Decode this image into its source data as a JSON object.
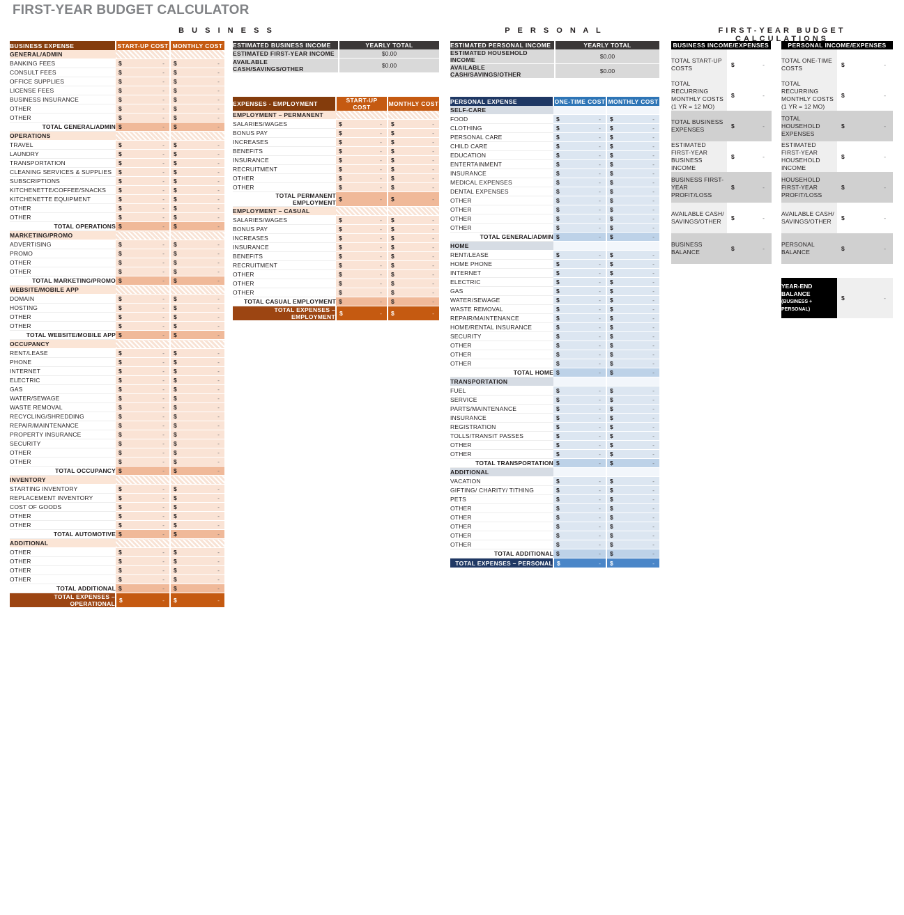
{
  "title": "FIRST-YEAR BUDGET CALCULATOR",
  "column_headings": {
    "business": "B U S I N E S S",
    "personal": "P E R S O N A L",
    "calculations": "FIRST-YEAR BUDGET CALCULATIONS"
  },
  "currency_symbol": "$",
  "empty_value": "-",
  "business_expense_table": {
    "header": {
      "label": "BUSINESS EXPENSE",
      "col1": "START-UP COST",
      "col2": "MONTHLY COST"
    },
    "sections": [
      {
        "name": "GENERAL/ADMIN",
        "items": [
          "BANKING FEES",
          "CONSULT FEES",
          "OFFICE SUPPLIES",
          "LICENSE FEES",
          "BUSINESS INSURANCE",
          "OTHER",
          "OTHER"
        ],
        "total_label": "TOTAL GENERAL/ADMIN"
      },
      {
        "name": "OPERATIONS",
        "items": [
          "TRAVEL",
          "LAUNDRY",
          "TRANSPORTATION",
          "CLEANING SERVICES & SUPPLIES",
          "SUBSCRIPTIONS",
          "KITCHENETTE/COFFEE/SNACKS",
          "KITCHENETTE EQUIPMENT",
          "OTHER",
          "OTHER"
        ],
        "total_label": "TOTAL OPERATIONS"
      },
      {
        "name": "MARKETING/PROMO",
        "items": [
          "ADVERTISING",
          "PROMO",
          "OTHER",
          "OTHER"
        ],
        "total_label": "TOTAL MARKETING/PROMO"
      },
      {
        "name": "WEBSITE/MOBILE APP",
        "items": [
          "DOMAIN",
          "HOSTING",
          "OTHER",
          "OTHER"
        ],
        "total_label": "TOTAL WEBSITE/MOBILE APP"
      },
      {
        "name": "OCCUPANCY",
        "items": [
          "RENT/LEASE",
          "PHONE",
          "INTERNET",
          "ELECTRIC",
          "GAS",
          "WATER/SEWAGE",
          "WASTE REMOVAL",
          "RECYCLING/SHREDDING",
          "REPAIR/MAINTENANCE",
          "PROPERTY INSURANCE",
          "SECURITY",
          "OTHER",
          "OTHER"
        ],
        "total_label": "TOTAL OCCUPANCY"
      },
      {
        "name": "INVENTORY",
        "items": [
          "STARTING INVENTORY",
          "REPLACEMENT INVENTORY",
          "COST OF GOODS",
          "OTHER",
          "OTHER"
        ],
        "total_label": "TOTAL AUTOMOTIVE"
      },
      {
        "name": "ADDITIONAL",
        "items": [
          "OTHER",
          "OTHER",
          "OTHER",
          "OTHER"
        ],
        "total_label": "TOTAL ADDITIONAL"
      }
    ],
    "grand_total_label": "TOTAL EXPENSES – OPERATIONAL"
  },
  "business_income_table": {
    "header": {
      "label": "ESTIMATED BUSINESS INCOME",
      "total": "YEARLY TOTAL"
    },
    "rows": [
      {
        "label": "ESTIMATED FIRST-YEAR INCOME",
        "value": "$0.00"
      },
      {
        "label": "AVAILABLE CASH/SAVINGS/OTHER",
        "value": "$0.00"
      }
    ]
  },
  "employment_table": {
    "header": {
      "label": "EXPENSES - EMPLOYMENT",
      "col1": "START-UP COST",
      "col2": "MONTHLY COST"
    },
    "sections": [
      {
        "name": "EMPLOYMENT – PERMANENT",
        "items": [
          "SALARIES/WAGES",
          "BONUS PAY",
          "INCREASES",
          "BENEFITS",
          "INSURANCE",
          "RECRUITMENT",
          "OTHER",
          "OTHER"
        ],
        "total_label": "TOTAL PERMANENT EMPLOYMENT"
      },
      {
        "name": "EMPLOYMENT – CASUAL",
        "items": [
          "SALARIES/WAGES",
          "BONUS PAY",
          "INCREASES",
          "INSURANCE",
          "BENEFITS",
          "RECRUITMENT",
          "OTHER",
          "OTHER",
          "OTHER"
        ],
        "total_label": "TOTAL CASUAL EMPLOYMENT"
      }
    ],
    "grand_total_label": "TOTAL EXPENSES – EMPLOYMENT"
  },
  "personal_income_table": {
    "header": {
      "label": "ESTIMATED PERSONAL INCOME",
      "total": "YEARLY TOTAL"
    },
    "rows": [
      {
        "label": "ESTIMATED HOUSEHOLD INCOME",
        "value": "$0.00"
      },
      {
        "label": "AVAILABLE CASH/SAVINGS/OTHER",
        "value": "$0.00"
      }
    ]
  },
  "personal_expense_table": {
    "header": {
      "label": "PERSONAL EXPENSE",
      "col1": "ONE-TIME COST",
      "col2": "MONTHLY COST"
    },
    "sections": [
      {
        "name": "SELF-CARE",
        "items": [
          "FOOD",
          "CLOTHING",
          "PERSONAL CARE",
          "CHILD CARE",
          "EDUCATION",
          "ENTERTAINMENT",
          "INSURANCE",
          "MEDICAL EXPENSES",
          "DENTAL EXPENSES",
          "OTHER",
          "OTHER",
          "OTHER",
          "OTHER"
        ],
        "total_label": "TOTAL GENERAL/ADMIN"
      },
      {
        "name": "HOME",
        "items": [
          "RENT/LEASE",
          "HOME PHONE",
          "INTERNET",
          "ELECTRIC",
          "GAS",
          "WATER/SEWAGE",
          "WASTE REMOVAL",
          "REPAIR/MAINTENANCE",
          "HOME/RENTAL INSURANCE",
          "SECURITY",
          "OTHER",
          "OTHER",
          "OTHER"
        ],
        "total_label": "TOTAL HOME"
      },
      {
        "name": "TRANSPORTATION",
        "items": [
          "FUEL",
          "SERVICE",
          "PARTS/MAINTENANCE",
          "INSURANCE",
          "REGISTRATION",
          "TOLLS/TRANSIT PASSES",
          "OTHER",
          "OTHER"
        ],
        "total_label": "TOTAL TRANSPORTATION"
      },
      {
        "name": "ADDITIONAL",
        "items": [
          "VACATION",
          "GIFTING/ CHARITY/ TITHING",
          "PETS",
          "OTHER",
          "OTHER",
          "OTHER",
          "OTHER",
          "OTHER"
        ],
        "total_label": "TOTAL ADDITIONAL"
      }
    ],
    "grand_total_label": "TOTAL EXPENSES – PERSONAL"
  },
  "calculations": {
    "header_business": "BUSINESS INCOME/EXPENSES",
    "header_personal": "PERSONAL INCOME/EXPENSES",
    "rows": [
      {
        "business": "TOTAL START-UP COSTS",
        "personal": "TOTAL ONE-TIME COSTS",
        "shade": "light"
      },
      {
        "business": "TOTAL RECURRING MONTHLY COSTS (1 YR = 12 MO)",
        "personal": "TOTAL RECURRING MONTHLY COSTS (1 YR = 12 MO)",
        "shade": "light"
      },
      {
        "business": "TOTAL BUSINESS EXPENSES",
        "personal": "TOTAL HOUSEHOLD EXPENSES",
        "shade": "grey"
      },
      {
        "business": "ESTIMATED FIRST-YEAR BUSINESS INCOME",
        "personal": "ESTIMATED FIRST-YEAR HOUSEHOLD INCOME",
        "shade": "light"
      },
      {
        "business": "BUSINESS FIRST-YEAR PROFIT/LOSS",
        "personal": "HOUSEHOLD FIRST-YEAR PROFIT/LOSS",
        "shade": "grey"
      },
      {
        "business": "AVAILABLE CASH/ SAVINGS/OTHER",
        "personal": "AVAILABLE CASH/ SAVINGS/OTHER",
        "shade": "light"
      },
      {
        "business": "BUSINESS BALANCE",
        "personal": "PERSONAL BALANCE",
        "shade": "grey"
      }
    ],
    "year_end": {
      "label": "YEAR-END BALANCE",
      "sub": "(BUSINESS + PERSONAL)"
    }
  }
}
